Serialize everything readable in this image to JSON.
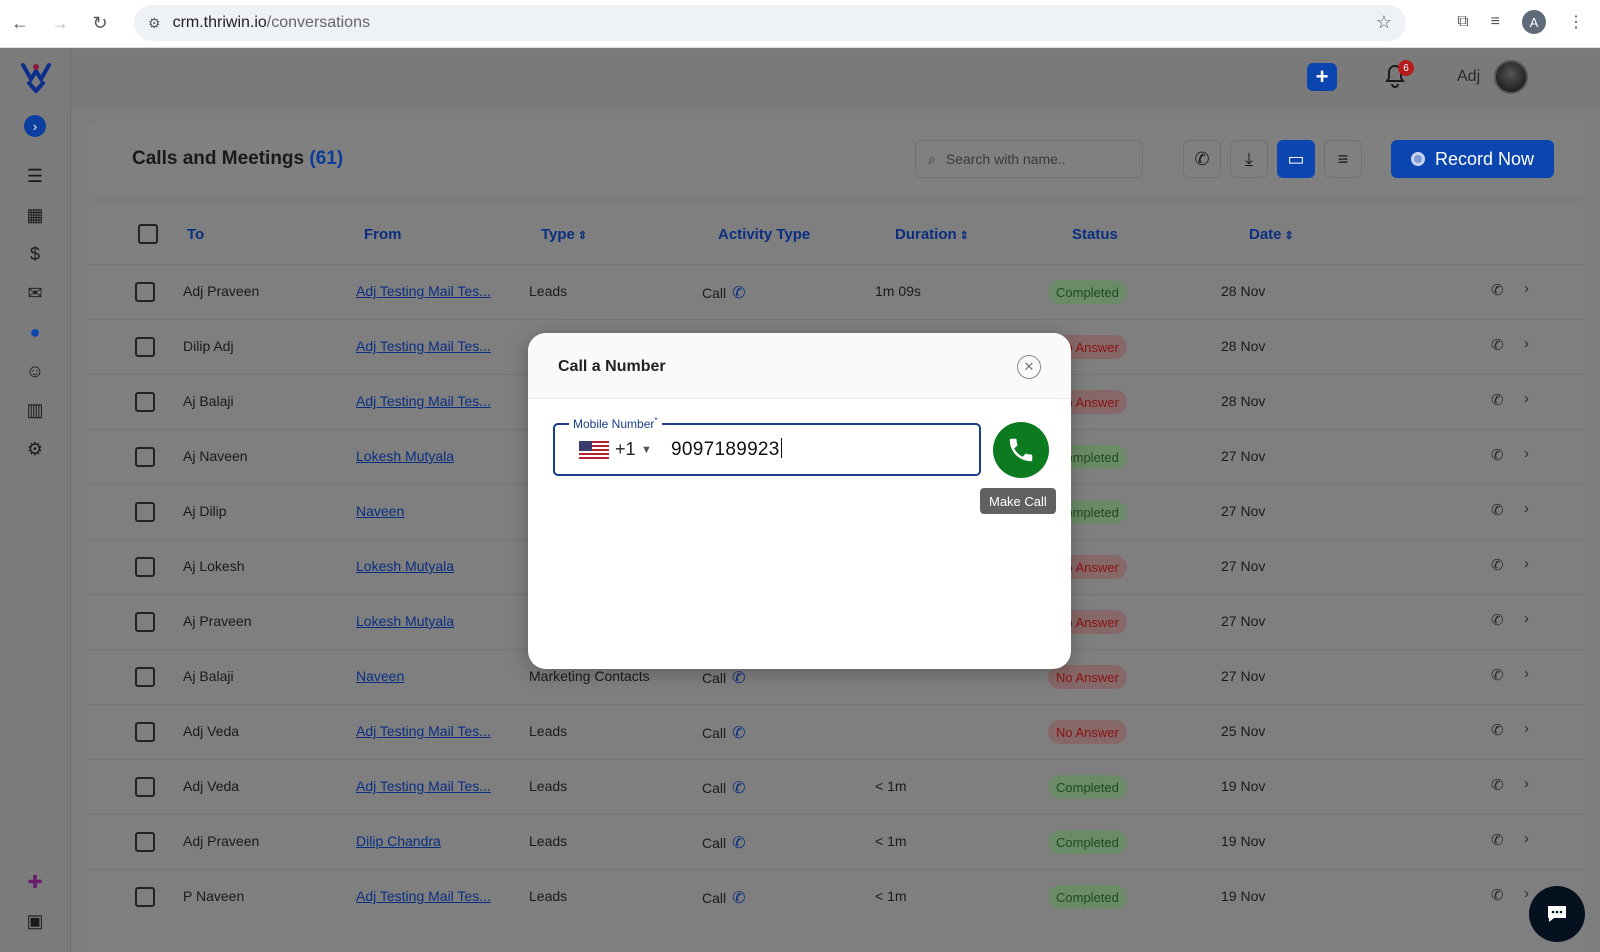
{
  "browser": {
    "url_host": "crm.thriwin.io",
    "url_path": "/conversations",
    "profile_initial": "A"
  },
  "topbar": {
    "notification_count": "6",
    "user_name": "Adj"
  },
  "page": {
    "title": "Calls and Meetings",
    "count": "(61)",
    "search_placeholder": "Search with name..",
    "record_label": "Record Now"
  },
  "table": {
    "headers": [
      "To",
      "From",
      "Type",
      "Activity Type",
      "Duration",
      "Status",
      "Date"
    ],
    "rows": [
      {
        "to": "Adj Praveen",
        "from": "Adj Testing Mail Tes...",
        "type": "Leads",
        "activity": "Call",
        "duration": "1m 09s",
        "status": "Completed",
        "date": "28 Nov"
      },
      {
        "to": "Dilip Adj",
        "from": "Adj Testing Mail Tes...",
        "type": "",
        "activity": "",
        "duration": "",
        "status": "No Answer",
        "date": "28 Nov"
      },
      {
        "to": "Aj Balaji",
        "from": "Adj Testing Mail Tes...",
        "type": "",
        "activity": "",
        "duration": "",
        "status": "No Answer",
        "date": "28 Nov"
      },
      {
        "to": "Aj Naveen",
        "from": "Lokesh Mutyala",
        "type": "",
        "activity": "",
        "duration": "",
        "status": "Completed",
        "date": "27 Nov"
      },
      {
        "to": "Aj Dilip",
        "from": "Naveen",
        "type": "",
        "activity": "",
        "duration": "",
        "status": "Completed",
        "date": "27 Nov"
      },
      {
        "to": "Aj Lokesh",
        "from": "Lokesh Mutyala",
        "type": "",
        "activity": "",
        "duration": "",
        "status": "No Answer",
        "date": "27 Nov"
      },
      {
        "to": "Aj Praveen",
        "from": "Lokesh Mutyala",
        "type": "",
        "activity": "",
        "duration": "",
        "status": "No Answer",
        "date": "27 Nov"
      },
      {
        "to": "Aj Balaji",
        "from": "Naveen",
        "type": "Marketing Contacts",
        "activity": "Call",
        "duration": "",
        "status": "No Answer",
        "date": "27 Nov"
      },
      {
        "to": "Adj Veda",
        "from": "Adj Testing Mail Tes...",
        "type": "Leads",
        "activity": "Call",
        "duration": "",
        "status": "No Answer",
        "date": "25 Nov"
      },
      {
        "to": "Adj Veda",
        "from": "Adj Testing Mail Tes...",
        "type": "Leads",
        "activity": "Call",
        "duration": "< 1m",
        "status": "Completed",
        "date": "19 Nov"
      },
      {
        "to": "Adj Praveen",
        "from": "Dilip Chandra",
        "type": "Leads",
        "activity": "Call",
        "duration": "< 1m",
        "status": "Completed",
        "date": "19 Nov"
      },
      {
        "to": "P Naveen",
        "from": "Adj Testing Mail Tes...",
        "type": "Leads",
        "activity": "Call",
        "duration": "< 1m",
        "status": "Completed",
        "date": "19 Nov"
      }
    ]
  },
  "modal": {
    "title": "Call a Number",
    "field_label": "Mobile Number",
    "required_mark": "*",
    "dial_code": "+1",
    "phone_value": "9097189923",
    "tooltip": "Make Call"
  },
  "colors": {
    "primary": "#0b45b0",
    "call_green": "#0c7a1e",
    "completed_text": "#1c4d17",
    "no_answer_text": "#8a1212"
  }
}
